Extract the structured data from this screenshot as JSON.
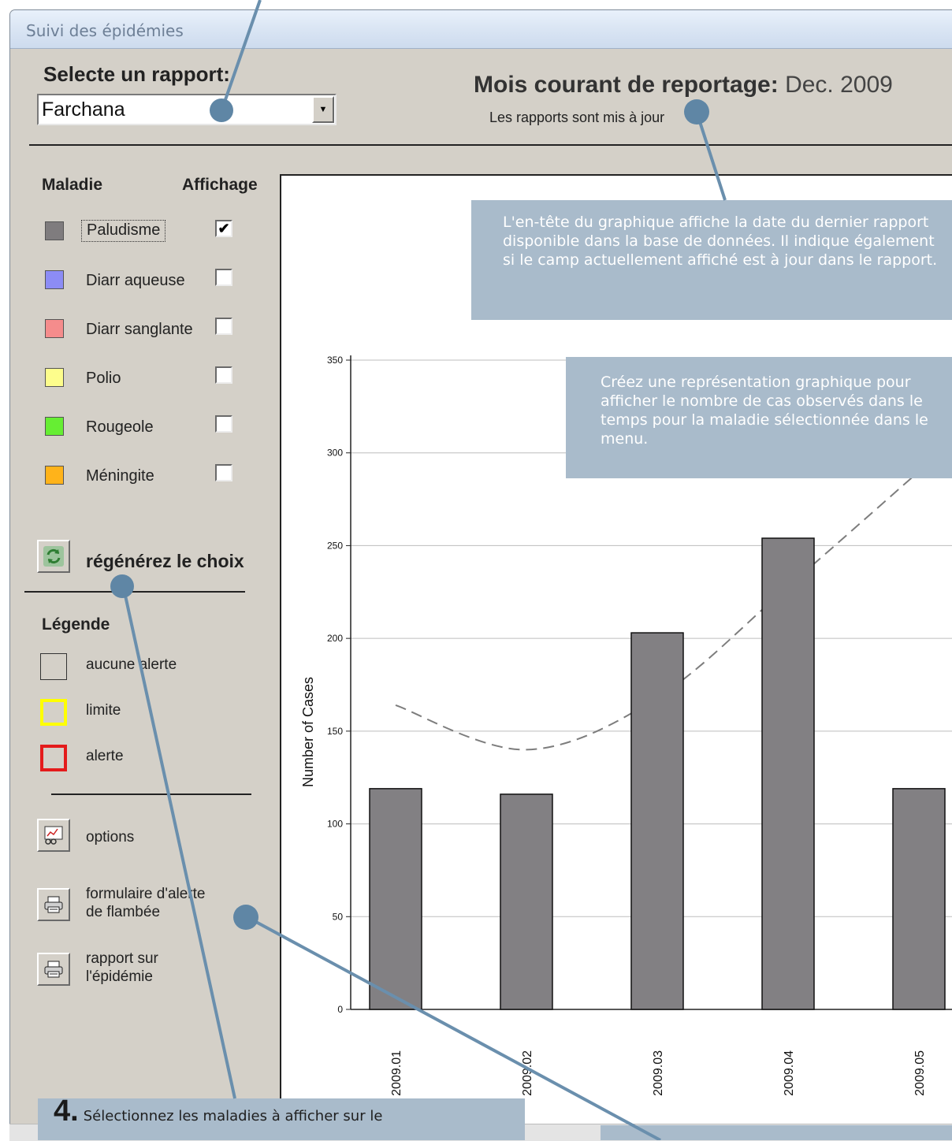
{
  "window": {
    "title": "Suivi des épidémies"
  },
  "header": {
    "select_label": "Selecte un rapport:",
    "selected_report": "Farchana",
    "month_label": "Mois courant de reportage:",
    "month_value": "Dec. 2009",
    "uptodate_text": "Les rapports sont mis à jour"
  },
  "sidebar": {
    "col_disease": "Maladie",
    "col_display": "Affichage",
    "diseases": [
      {
        "label": "Paludisme",
        "color": "#7f7c7e",
        "checked": true,
        "mark": "✔"
      },
      {
        "label": "Diarr aqueuse",
        "color": "#8c8cf5",
        "checked": false,
        "mark": ""
      },
      {
        "label": "Diarr sanglante",
        "color": "#f58c8c",
        "checked": false,
        "mark": ""
      },
      {
        "label": "Polio",
        "color": "#fdfd8c",
        "checked": false,
        "mark": ""
      },
      {
        "label": "Rougeole",
        "color": "#66ee33",
        "checked": false,
        "mark": ""
      },
      {
        "label": "Méningite",
        "color": "#ffb31a",
        "checked": false,
        "mark": ""
      }
    ],
    "regen_label": "régénérez le choix",
    "legend_title": "Légende",
    "legend": [
      {
        "label": "aucune alerte",
        "border": "#333333"
      },
      {
        "label": "limite",
        "border": "#ffff00"
      },
      {
        "label": "alerte",
        "border": "#e41b1b"
      }
    ],
    "options_label": "options",
    "form_label_1": "formulaire d'alerte",
    "form_label_2": "de flambée",
    "report_label_1": "rapport sur",
    "report_label_2": "l'épidémie"
  },
  "callouts": {
    "top": "L'en-tête du graphique affiche la date du dernier rapport disponible dans la base de données. Il indique également si le camp actuellement affiché est à jour dans le rapport.",
    "chart": "Créez une représentation graphique pour afficher le nombre de cas observés dans le temps pour la maladie sélectionnée dans le menu.",
    "step_number": "4.",
    "step_text": "Sélectionnez les maladies à afficher sur le"
  },
  "chart_data": {
    "type": "bar",
    "title": "",
    "ylabel": "Number of Cases",
    "xlabel": "",
    "ylim": [
      0,
      350
    ],
    "yticks": [
      0,
      50,
      100,
      150,
      200,
      250,
      300,
      350
    ],
    "categories": [
      "2009.01",
      "2009.02",
      "2009.03",
      "2009.04",
      "2009.05"
    ],
    "series": [
      {
        "values": [
          119,
          116,
          203,
          254,
          119
        ],
        "color": "#828083"
      }
    ],
    "trend_line": {
      "style": "dashed",
      "color": "#7d7d7d",
      "x": [
        "2009.01",
        "2009.02",
        "2009.03",
        "2009.04",
        "2009.05"
      ],
      "y": [
        164,
        140,
        168,
        228,
        290
      ]
    },
    "grid": true
  }
}
